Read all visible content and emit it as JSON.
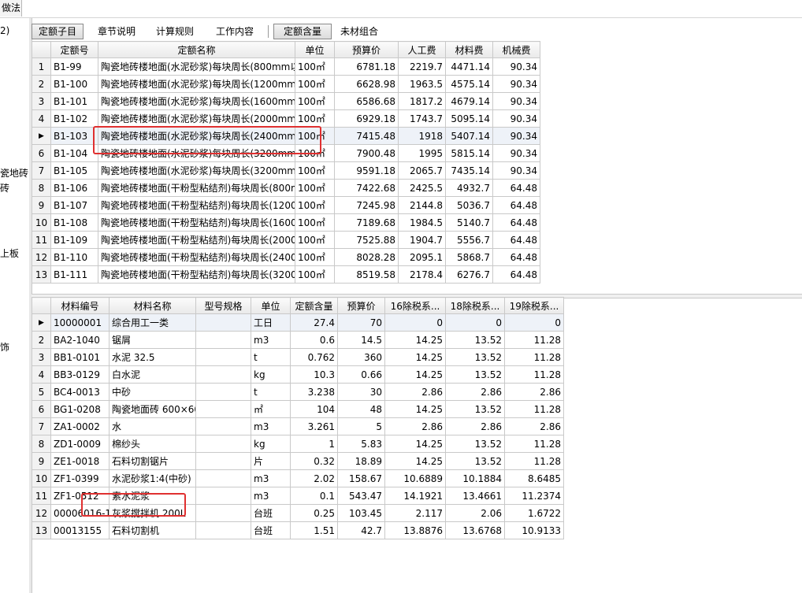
{
  "top_tab": "做法",
  "left_panel": [
    "2)",
    "瓷地砖",
    "砖",
    "上板",
    "饰"
  ],
  "tabs": [
    {
      "label": "定额子目",
      "active": true
    },
    {
      "label": "章节说明",
      "active": false
    },
    {
      "label": "计算规则",
      "active": false
    },
    {
      "label": "工作内容",
      "active": false
    },
    {
      "label": "定额含量",
      "active": true
    },
    {
      "label": "未材组合",
      "active": false
    }
  ],
  "quota_table": {
    "headers": [
      "定额号",
      "定额名称",
      "单位",
      "预算价",
      "人工费",
      "材料费",
      "机械费"
    ],
    "rows": [
      {
        "n": "1",
        "code": "B1-99",
        "name": "陶瓷地砖楼地面(水泥砂浆)每块周长(800mm以",
        "unit": "100㎡",
        "price": "6781.18",
        "labor": "2219.7",
        "material": "4471.14",
        "machine": "90.34"
      },
      {
        "n": "2",
        "code": "B1-100",
        "name": "陶瓷地砖楼地面(水泥砂浆)每块周长(1200mml",
        "unit": "100㎡",
        "price": "6628.98",
        "labor": "1963.5",
        "material": "4575.14",
        "machine": "90.34"
      },
      {
        "n": "3",
        "code": "B1-101",
        "name": "陶瓷地砖楼地面(水泥砂浆)每块周长(1600mml",
        "unit": "100㎡",
        "price": "6586.68",
        "labor": "1817.2",
        "material": "4679.14",
        "machine": "90.34"
      },
      {
        "n": "4",
        "code": "B1-102",
        "name": "陶瓷地砖楼地面(水泥砂浆)每块周长(2000mml",
        "unit": "100㎡",
        "price": "6929.18",
        "labor": "1743.7",
        "material": "5095.14",
        "machine": "90.34"
      },
      {
        "n": "▶",
        "code": "B1-103",
        "name": "陶瓷地砖楼地面(水泥砂浆)每块周长(2400mml",
        "unit": "100㎡",
        "price": "7415.48",
        "labor": "1918",
        "material": "5407.14",
        "machine": "90.34",
        "selected": true
      },
      {
        "n": "6",
        "code": "B1-104",
        "name": "陶瓷地砖楼地面(水泥砂浆)每块周长(3200mml",
        "unit": "100㎡",
        "price": "7900.48",
        "labor": "1995",
        "material": "5815.14",
        "machine": "90.34"
      },
      {
        "n": "7",
        "code": "B1-105",
        "name": "陶瓷地砖楼地面(水泥砂浆)每块周长(3200mml",
        "unit": "100㎡",
        "price": "9591.18",
        "labor": "2065.7",
        "material": "7435.14",
        "machine": "90.34"
      },
      {
        "n": "8",
        "code": "B1-106",
        "name": "陶瓷地砖楼地面(干粉型粘结剂)每块周长(800m",
        "unit": "100㎡",
        "price": "7422.68",
        "labor": "2425.5",
        "material": "4932.7",
        "machine": "64.48"
      },
      {
        "n": "9",
        "code": "B1-107",
        "name": "陶瓷地砖楼地面(干粉型粘结剂)每块周长(1200",
        "unit": "100㎡",
        "price": "7245.98",
        "labor": "2144.8",
        "material": "5036.7",
        "machine": "64.48"
      },
      {
        "n": "10",
        "code": "B1-108",
        "name": "陶瓷地砖楼地面(干粉型粘结剂)每块周长(1600",
        "unit": "100㎡",
        "price": "7189.68",
        "labor": "1984.5",
        "material": "5140.7",
        "machine": "64.48"
      },
      {
        "n": "11",
        "code": "B1-109",
        "name": "陶瓷地砖楼地面(干粉型粘结剂)每块周长(2000",
        "unit": "100㎡",
        "price": "7525.88",
        "labor": "1904.7",
        "material": "5556.7",
        "machine": "64.48"
      },
      {
        "n": "12",
        "code": "B1-110",
        "name": "陶瓷地砖楼地面(干粉型粘结剂)每块周长(2400",
        "unit": "100㎡",
        "price": "8028.28",
        "labor": "2095.1",
        "material": "5868.7",
        "machine": "64.48"
      },
      {
        "n": "13",
        "code": "B1-111",
        "name": "陶瓷地砖楼地面(干粉型粘结剂)每块周长(3200",
        "unit": "100㎡",
        "price": "8519.58",
        "labor": "2178.4",
        "material": "6276.7",
        "machine": "64.48"
      }
    ]
  },
  "material_table": {
    "headers": [
      "材料编号",
      "材料名称",
      "型号规格",
      "单位",
      "定额含量",
      "预算价",
      "16除税系...",
      "18除税系...",
      "19除税系..."
    ],
    "rows": [
      {
        "n": "▶",
        "code": "10000001",
        "name": "综合用工一类",
        "spec": "",
        "unit": "工日",
        "qty": "27.4",
        "price": "70",
        "r16": "0",
        "r18": "0",
        "r19": "0",
        "selected": true
      },
      {
        "n": "2",
        "code": "BA2-1040",
        "name": "锯屑",
        "spec": "",
        "unit": "m3",
        "qty": "0.6",
        "price": "14.5",
        "r16": "14.25",
        "r18": "13.52",
        "r19": "11.28"
      },
      {
        "n": "3",
        "code": "BB1-0101",
        "name": "水泥 32.5",
        "spec": "",
        "unit": "t",
        "qty": "0.762",
        "price": "360",
        "r16": "14.25",
        "r18": "13.52",
        "r19": "11.28"
      },
      {
        "n": "4",
        "code": "BB3-0129",
        "name": "白水泥",
        "spec": "",
        "unit": "kg",
        "qty": "10.3",
        "price": "0.66",
        "r16": "14.25",
        "r18": "13.52",
        "r19": "11.28"
      },
      {
        "n": "5",
        "code": "BC4-0013",
        "name": "中砂",
        "spec": "",
        "unit": "t",
        "qty": "3.238",
        "price": "30",
        "r16": "2.86",
        "r18": "2.86",
        "r19": "2.86"
      },
      {
        "n": "6",
        "code": "BG1-0208",
        "name": "陶瓷地面砖 600×60",
        "spec": "",
        "unit": "㎡",
        "qty": "104",
        "price": "48",
        "r16": "14.25",
        "r18": "13.52",
        "r19": "11.28"
      },
      {
        "n": "7",
        "code": "ZA1-0002",
        "name": "水",
        "spec": "",
        "unit": "m3",
        "qty": "3.261",
        "price": "5",
        "r16": "2.86",
        "r18": "2.86",
        "r19": "2.86"
      },
      {
        "n": "8",
        "code": "ZD1-0009",
        "name": "棉纱头",
        "spec": "",
        "unit": "kg",
        "qty": "1",
        "price": "5.83",
        "r16": "14.25",
        "r18": "13.52",
        "r19": "11.28"
      },
      {
        "n": "9",
        "code": "ZE1-0018",
        "name": "石料切割锯片",
        "spec": "",
        "unit": "片",
        "qty": "0.32",
        "price": "18.89",
        "r16": "14.25",
        "r18": "13.52",
        "r19": "11.28"
      },
      {
        "n": "10",
        "code": "ZF1-0399",
        "name": "水泥砂浆1:4(中砂)",
        "spec": "",
        "unit": "m3",
        "qty": "2.02",
        "price": "158.67",
        "r16": "10.6889",
        "r18": "10.1884",
        "r19": "8.6485"
      },
      {
        "n": "11",
        "code": "ZF1-0512",
        "name": "素水泥浆",
        "spec": "",
        "unit": "m3",
        "qty": "0.1",
        "price": "543.47",
        "r16": "14.1921",
        "r18": "13.4661",
        "r19": "11.2374"
      },
      {
        "n": "12",
        "code": "00006016-1",
        "name": "灰浆搅拌机 200L",
        "spec": "",
        "unit": "台班",
        "qty": "0.25",
        "price": "103.45",
        "r16": "2.117",
        "r18": "2.06",
        "r19": "1.6722"
      },
      {
        "n": "13",
        "code": "00013155",
        "name": "石料切割机",
        "spec": "",
        "unit": "台班",
        "qty": "1.51",
        "price": "42.7",
        "r16": "13.8876",
        "r18": "13.6768",
        "r19": "10.9133"
      }
    ]
  },
  "highlight_color": "#e03030"
}
